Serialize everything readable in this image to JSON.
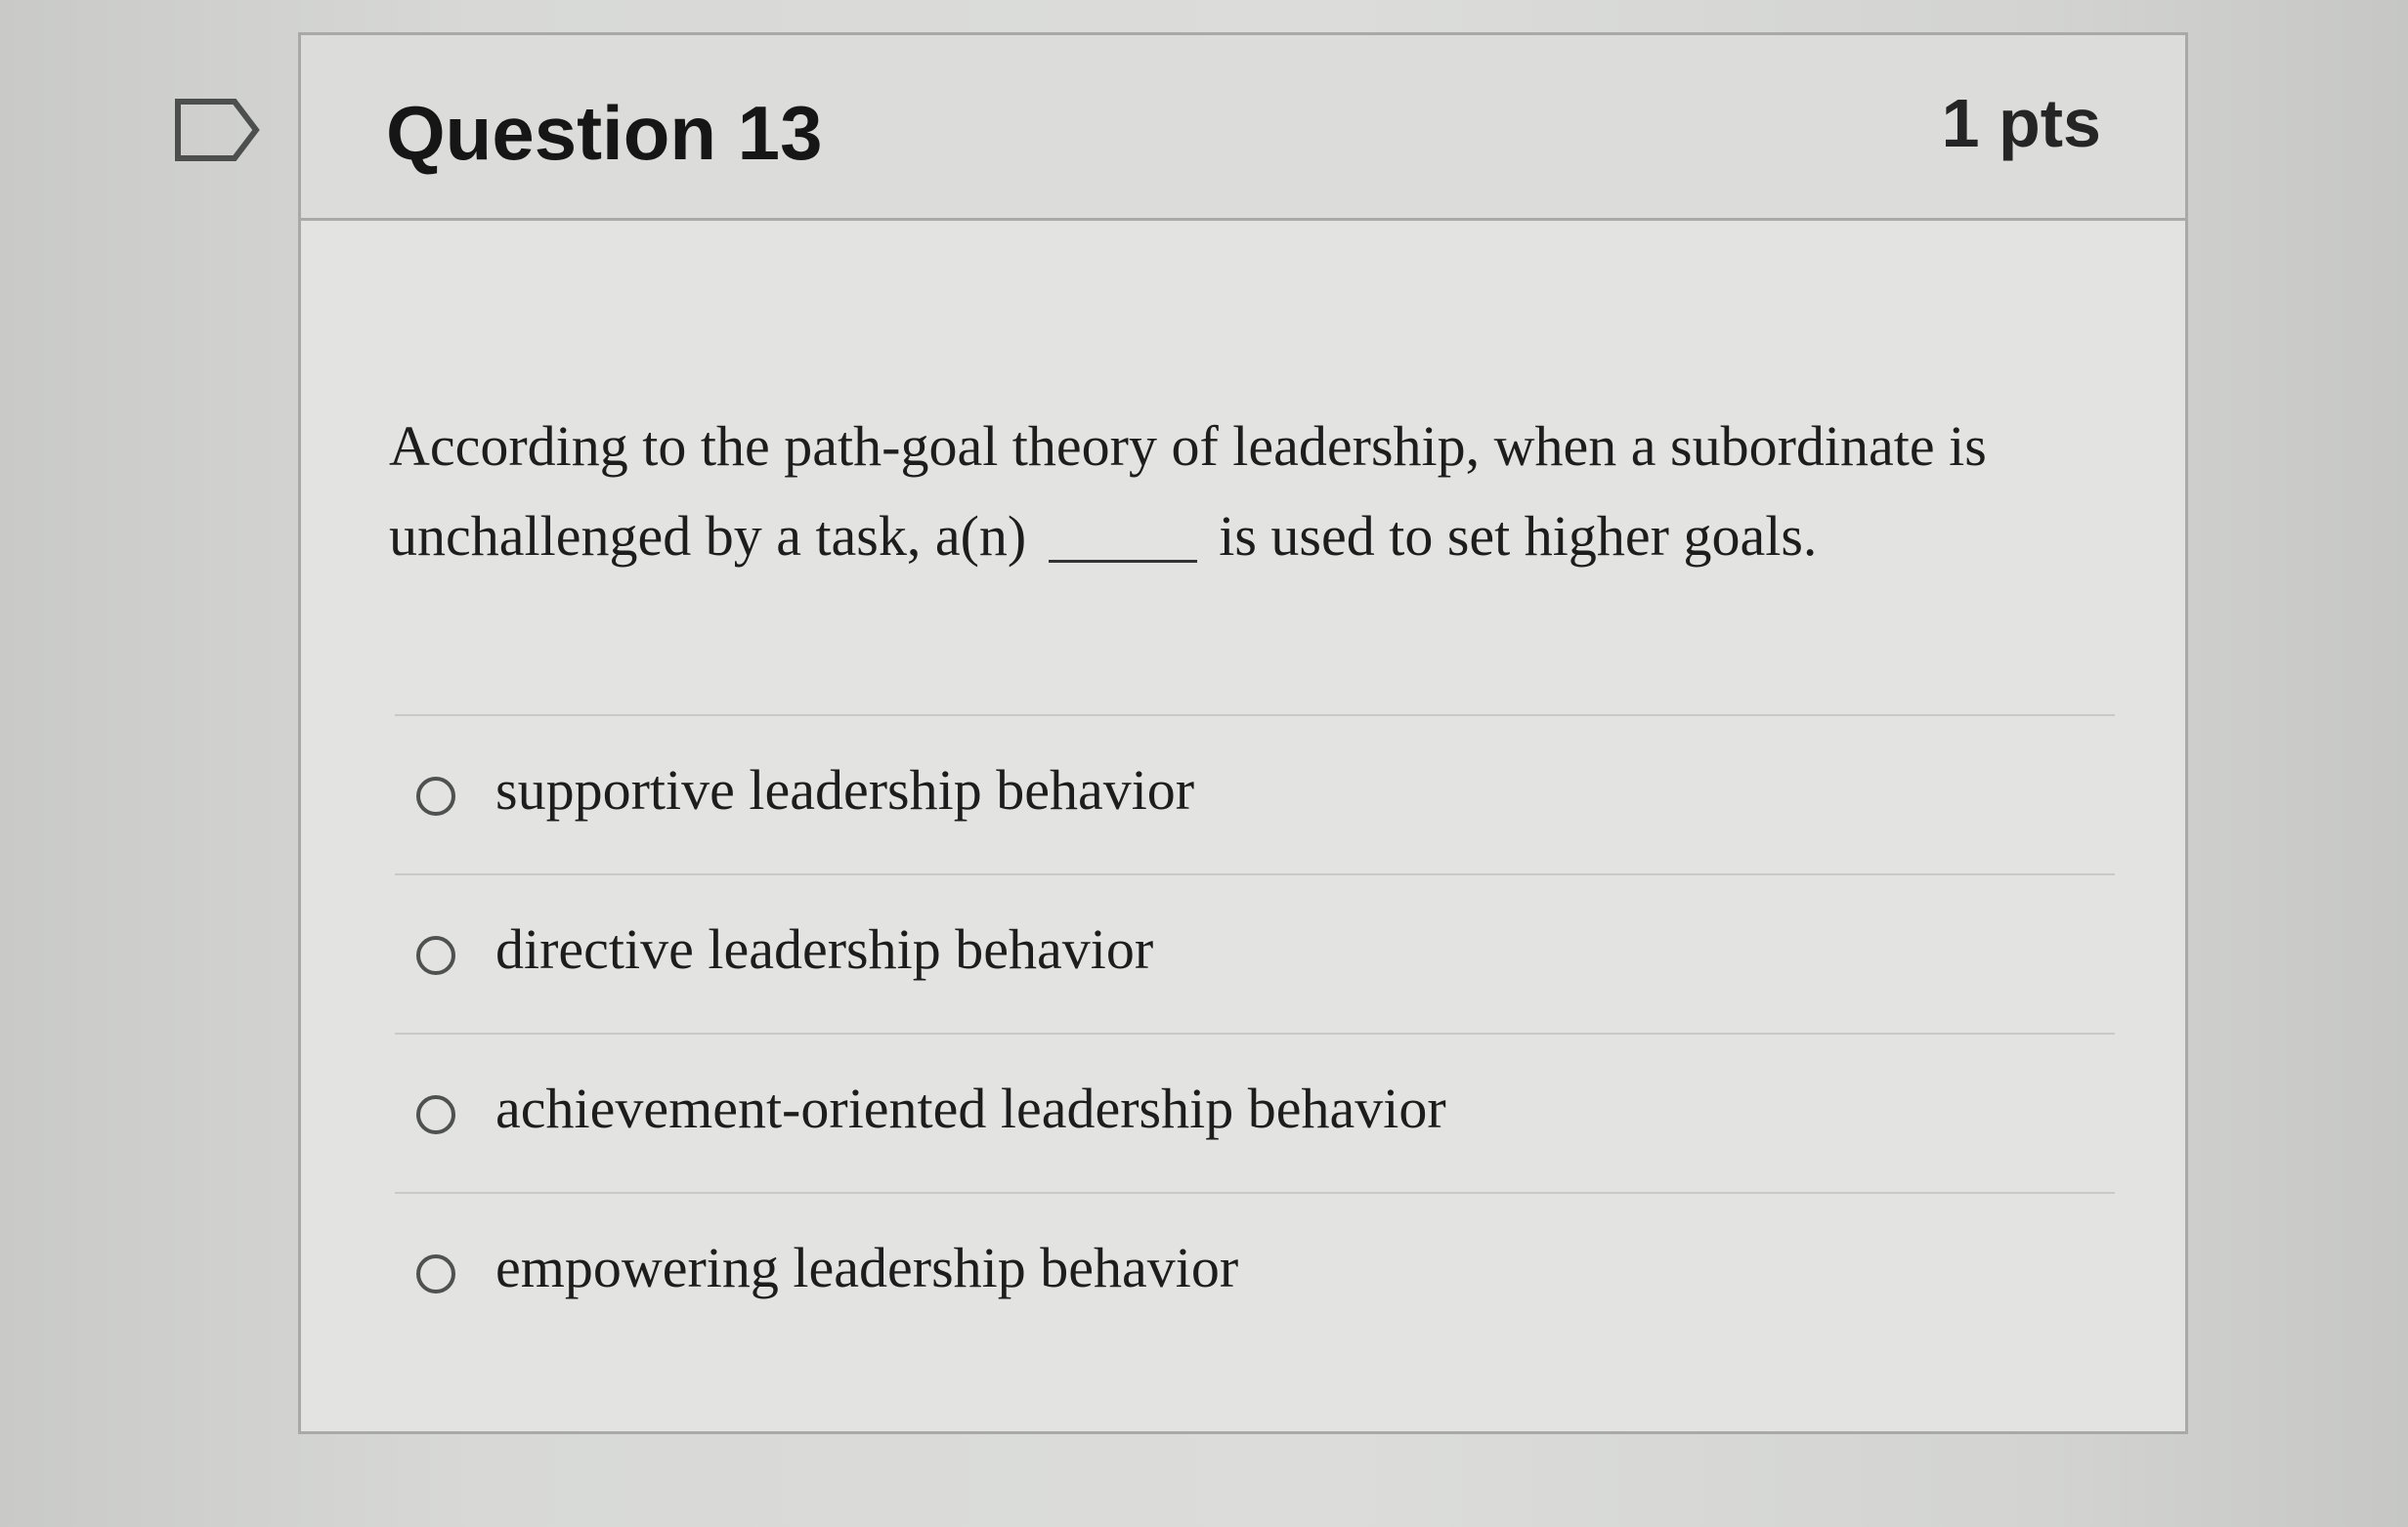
{
  "question": {
    "title": "Question 13",
    "points": "1 pts",
    "text_before_blank": "According to the path-goal theory of leadership, when a subordinate is unchallenged by a task, a(n)",
    "text_after_blank": "is used to set higher goals."
  },
  "answers": [
    {
      "label": "supportive leadership behavior"
    },
    {
      "label": "directive leadership behavior"
    },
    {
      "label": "achievement-oriented leadership behavior"
    },
    {
      "label": "empowering leadership behavior"
    }
  ],
  "icons": {
    "flag": "flag-question-icon",
    "radio": "radio-unselected-icon"
  }
}
